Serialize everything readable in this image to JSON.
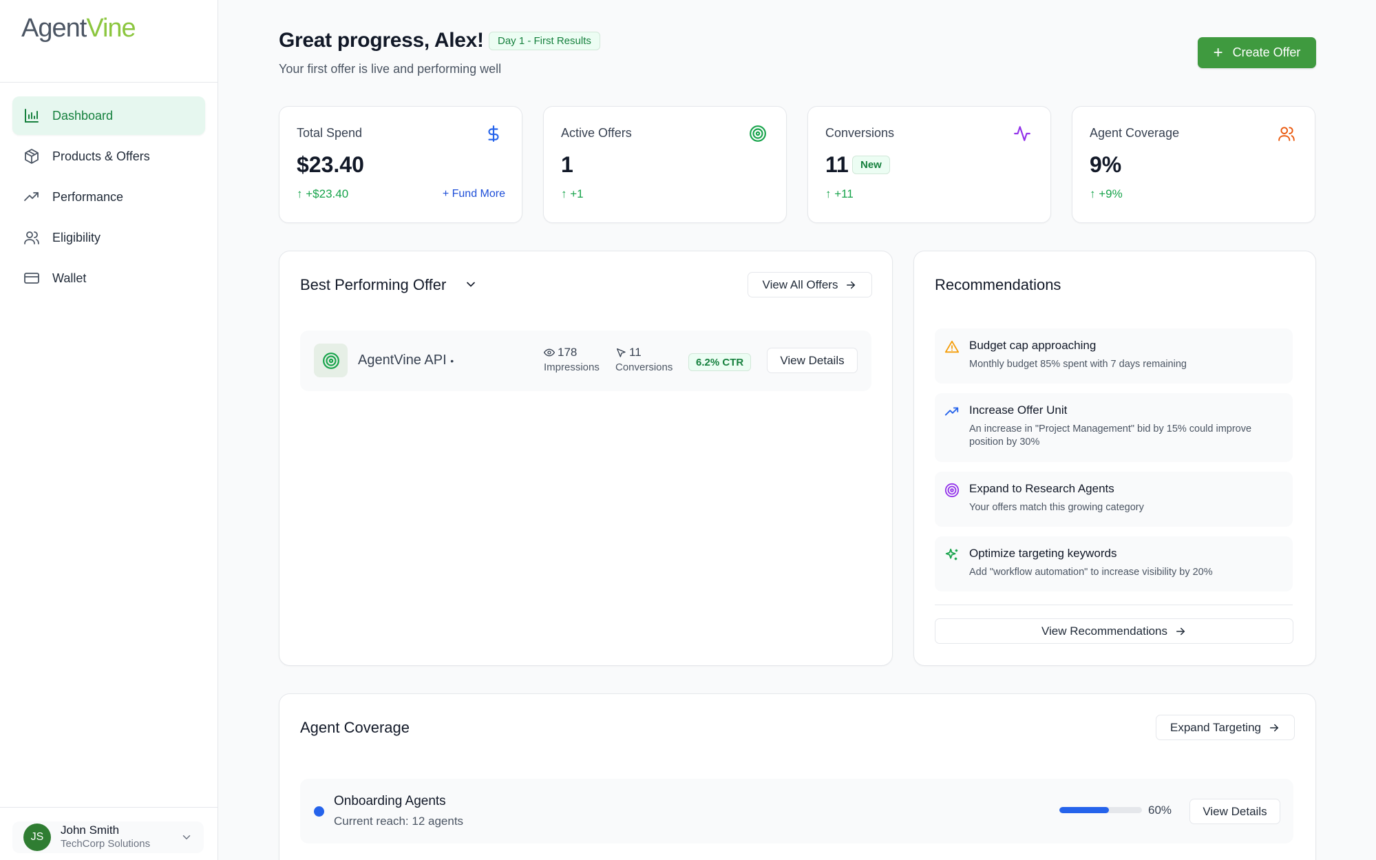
{
  "brand": {
    "logo_part1": "Agent",
    "logo_part2": "Vine"
  },
  "sidebar": {
    "items": [
      {
        "label": "Dashboard",
        "icon": "bar-chart-icon",
        "active": true
      },
      {
        "label": "Products & Offers",
        "icon": "box-icon"
      },
      {
        "label": "Performance",
        "icon": "trending-up-icon"
      },
      {
        "label": "Eligibility",
        "icon": "users-icon"
      },
      {
        "label": "Wallet",
        "icon": "credit-card-icon"
      }
    ],
    "user": {
      "initials": "JS",
      "name": "John Smith",
      "org": "TechCorp Solutions"
    }
  },
  "header": {
    "greeting": "Great progress, Alex!",
    "badge": "Day 1 - First Results",
    "subtitle": "Your first offer is live and performing well",
    "create_label": "Create Offer"
  },
  "stats": [
    {
      "label": "Total Spend",
      "value": "$23.40",
      "change": "+$23.40",
      "link": "+ Fund More",
      "icon": "dollar-icon",
      "color": "#2563eb"
    },
    {
      "label": "Active Offers",
      "value": "1",
      "change": "+1",
      "icon": "target-icon",
      "color": "#16a34a"
    },
    {
      "label": "Conversions",
      "value": "11",
      "badge": "New",
      "change": "+11",
      "icon": "activity-icon",
      "color": "#9333ea"
    },
    {
      "label": "Agent Coverage",
      "value": "9%",
      "change": "+9%",
      "icon": "users-icon",
      "color": "#ea580c"
    }
  ],
  "best_offer": {
    "title": "Best Performing Offer",
    "view_all": "View All Offers",
    "offer": {
      "name": "AgentVine API",
      "separator": "•",
      "impressions": "178",
      "impressions_label": "Impressions",
      "conversions": "11",
      "conversions_label": "Conversions",
      "ctr": "6.2% CTR",
      "details_label": "View Details"
    }
  },
  "recommendations": {
    "title": "Recommendations",
    "items": [
      {
        "title": "Budget cap approaching",
        "desc": "Monthly budget 85% spent with 7 days remaining",
        "icon": "warning-icon",
        "color": "#f59e0b"
      },
      {
        "title": "Increase Offer Unit",
        "desc": "An increase in \"Project Management\" bid by 15% could improve position by 30%",
        "icon": "trending-up-icon",
        "color": "#2563eb"
      },
      {
        "title": "Expand to Research Agents",
        "desc": "Your offers match this growing category",
        "icon": "target-icon",
        "color": "#9333ea"
      },
      {
        "title": "Optimize targeting keywords",
        "desc": "Add \"workflow automation\" to increase visibility by 20%",
        "icon": "sparkles-icon",
        "color": "#16a34a"
      }
    ],
    "view_label": "View Recommendations"
  },
  "coverage": {
    "title": "Agent Coverage",
    "expand_label": "Expand Targeting",
    "rows": [
      {
        "name": "Onboarding Agents",
        "reach": "Current reach: 12 agents",
        "percent_label": "60%",
        "progress": 0.6,
        "details_label": "View Details",
        "dot_color": "#2563eb"
      }
    ]
  },
  "colors": {
    "accent": "#3f9a3f",
    "brand_green": "#8cc63f",
    "positive": "#16a34a"
  }
}
